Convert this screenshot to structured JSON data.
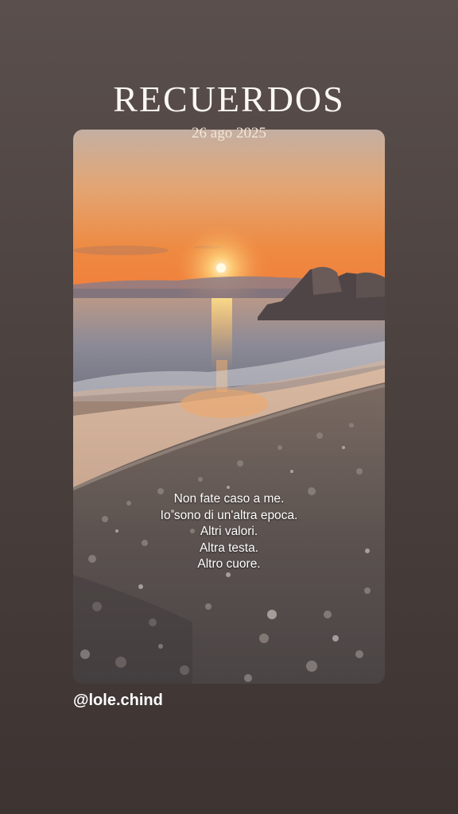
{
  "story": {
    "title": "RECUERDOS",
    "date": "26 ago 2025",
    "handle": "@lole.chind"
  },
  "photo": {
    "overlay_lines": [
      "Non fate caso a me.",
      "Io sono di un'altra epoca.",
      "Altri valori.",
      "Altra testa.",
      "Altro cuore."
    ]
  },
  "colors": {
    "background": "#4b413f",
    "title_text": "#fbf7f2",
    "sky_top": "#c9b2a2",
    "sky_horizon": "#f08a40",
    "sun": "#fff3c4"
  }
}
